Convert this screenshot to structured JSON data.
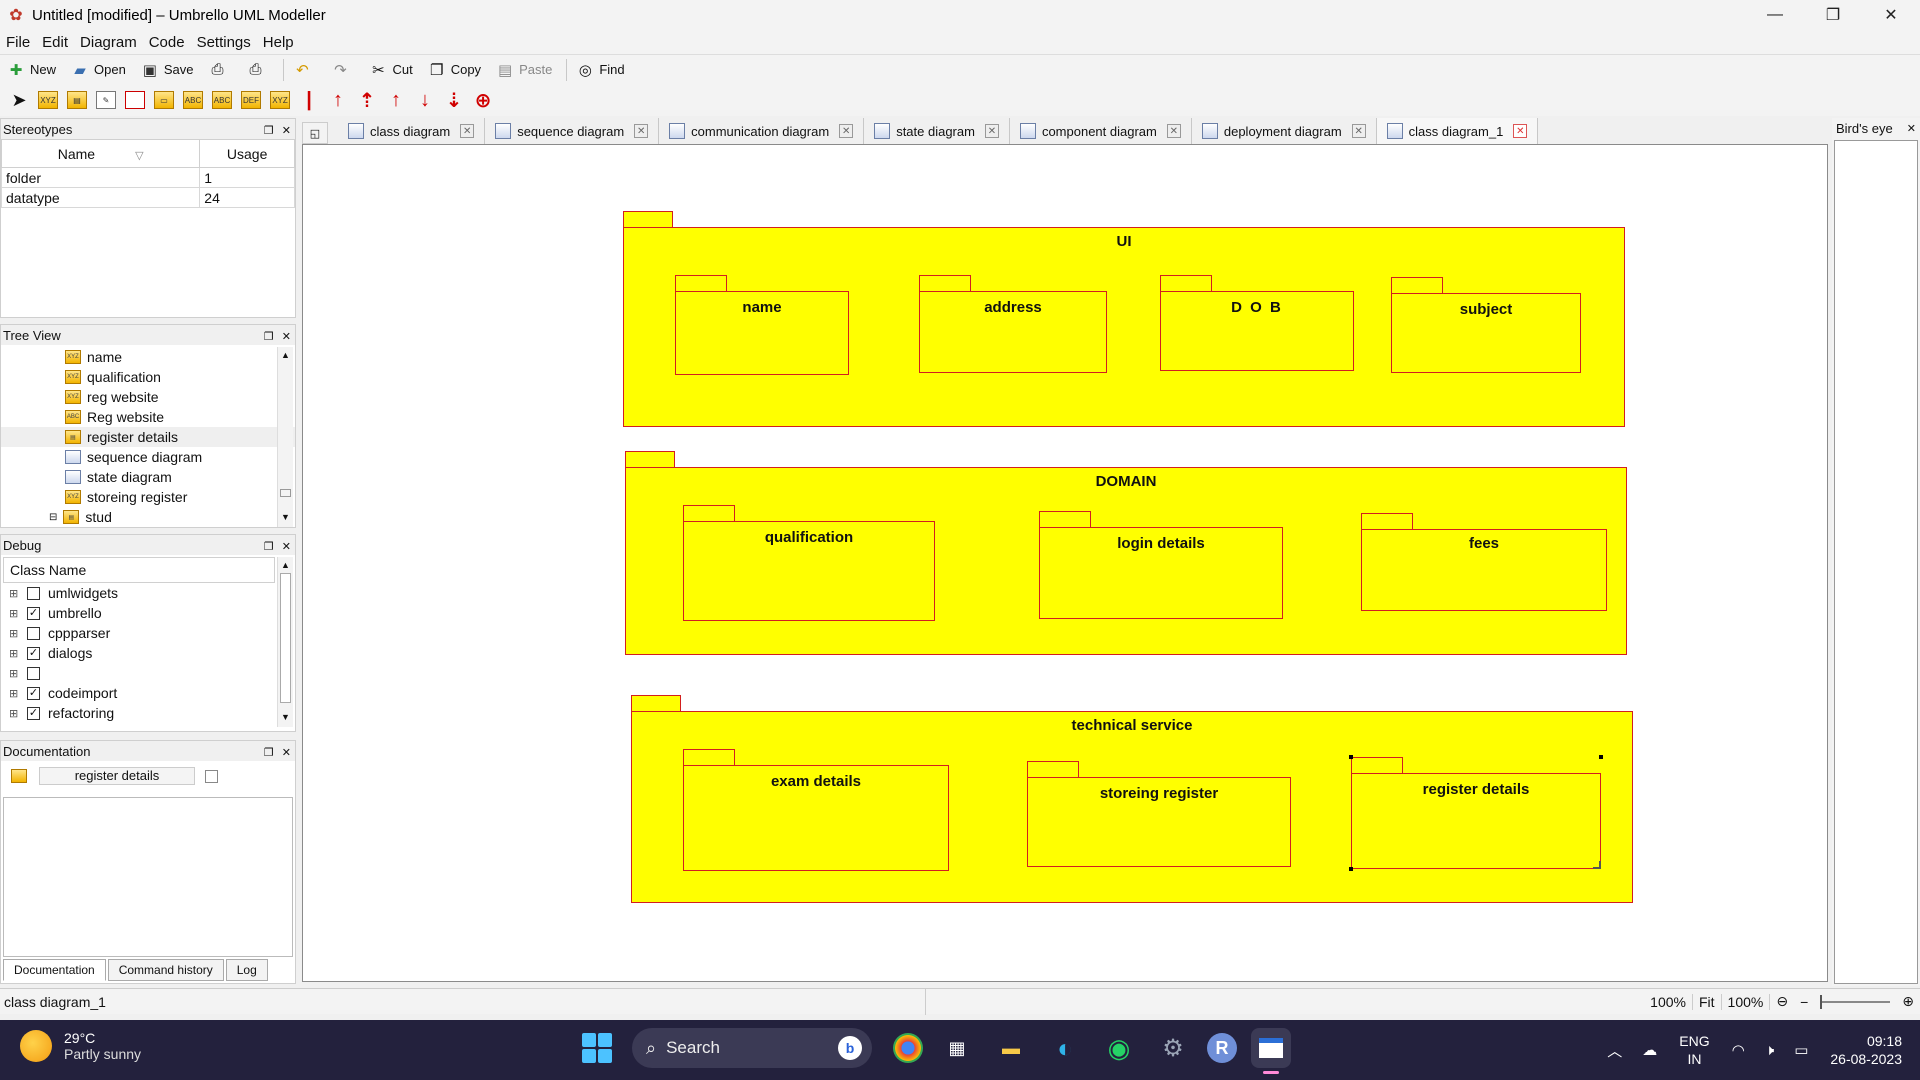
{
  "window": {
    "title": "Untitled [modified] – Umbrello UML Modeller",
    "controls": [
      "—",
      "❐",
      "✕"
    ]
  },
  "menu": [
    "File",
    "Edit",
    "Diagram",
    "Code",
    "Settings",
    "Help"
  ],
  "toolbar": {
    "new": "New",
    "open": "Open",
    "save": "Save",
    "cut": "Cut",
    "copy": "Copy",
    "paste": "Paste",
    "find": "Find"
  },
  "stereotypes": {
    "title": "Stereotypes",
    "col_name": "Name",
    "col_usage": "Usage",
    "rows": [
      {
        "name": "folder",
        "usage": "1"
      },
      {
        "name": "datatype",
        "usage": "24"
      }
    ]
  },
  "tree_view": {
    "title": "Tree View",
    "items": [
      "name",
      "qualification",
      "reg website",
      "Reg website",
      "register details",
      "sequence diagram",
      "state diagram",
      "storeing register",
      "stud"
    ]
  },
  "debug": {
    "title": "Debug",
    "col_class": "Class Name",
    "items": [
      {
        "label": "umlwidgets",
        "checked": false
      },
      {
        "label": "umbrello",
        "checked": true
      },
      {
        "label": "cppparser",
        "checked": false
      },
      {
        "label": "dialogs",
        "checked": true
      },
      {
        "label": "",
        "checked": false
      },
      {
        "label": "codeimport",
        "checked": true
      },
      {
        "label": "refactoring",
        "checked": true
      }
    ]
  },
  "documentation": {
    "title": "Documentation",
    "field": "register details",
    "tabs": [
      "Documentation",
      "Command history",
      "Log"
    ]
  },
  "tabs": [
    "class diagram",
    "sequence diagram",
    "communication diagram",
    "state diagram",
    "component diagram",
    "deployment diagram",
    "class diagram_1"
  ],
  "diagram": {
    "packages": {
      "ui": "UI",
      "domain": "DOMAIN",
      "technical": "technical service"
    },
    "ui_children": [
      "name",
      "address",
      "D O B",
      "subject"
    ],
    "domain_children": [
      "qualification",
      "login details",
      "fees"
    ],
    "technical_children": [
      "exam details",
      "storeing register",
      "register details"
    ],
    "colors": {
      "fill": "#ffff00",
      "border": "#d21f1f"
    }
  },
  "birds_eye": {
    "title": "Bird's eye"
  },
  "status": {
    "left": "class diagram_1",
    "zoom1": "100%",
    "fit": "Fit",
    "zoom2": "100%"
  },
  "taskbar": {
    "temp": "29°C",
    "weather": "Partly sunny",
    "search": "Search",
    "lang1": "ENG",
    "lang2": "IN",
    "time": "09:18",
    "date": "26-08-2023"
  }
}
